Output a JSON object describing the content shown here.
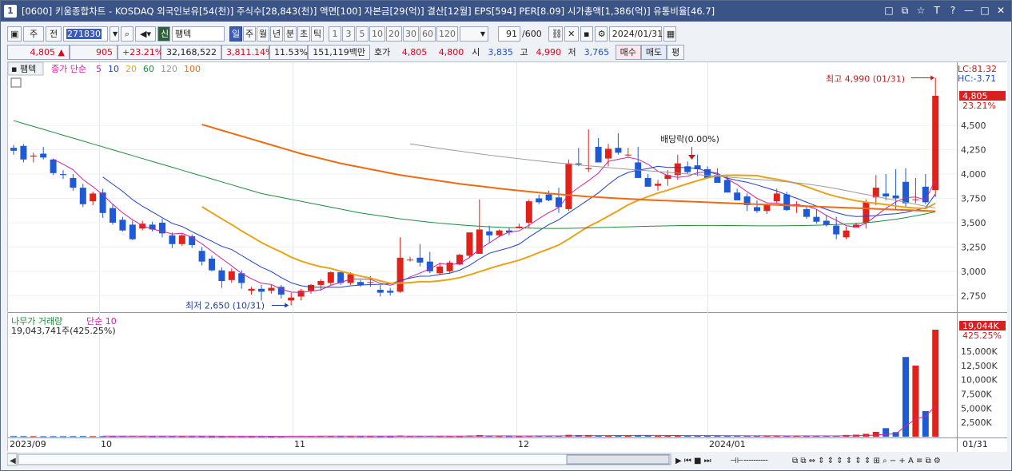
{
  "window": {
    "number": "1",
    "title": "[0600] 키움종합차트 - KOSDAQ 외국인보유[54(천)] 주식수[28,843(천)] 액면[100] 자본금[29(억)] 결산[12월] EPS[594] PER[8.09] 시가총액[1,386(억)] 유통비율[46.7]",
    "controls": [
      "□",
      "⧉",
      "☆",
      "T",
      "?",
      "—",
      "□",
      "✕"
    ]
  },
  "toolbar": {
    "period_label": "주",
    "prev_label": "전",
    "code": "271830",
    "market_badge": "신",
    "stock_name": "팸텍",
    "period_buttons": [
      "일",
      "주",
      "월",
      "년",
      "분",
      "초",
      "틱"
    ],
    "active_period": "일",
    "interval_buttons": [
      "1",
      "3",
      "5",
      "10",
      "20",
      "30",
      "60",
      "120"
    ],
    "count": "91",
    "count_total": "/600",
    "date": "2024/01/31"
  },
  "quote": {
    "price": "4,805",
    "change_arrow": "▲",
    "change": "905",
    "change_pct": "+23.21%",
    "volume": "32,168,522",
    "volume_pct": "3,811.14%",
    "turnover": "11.53%",
    "amount": "151,119백만",
    "hoga_label": "호가",
    "ask": "4,805",
    "bid": "4,800",
    "open_label": "시",
    "open": "3,835",
    "high_label": "고",
    "high": "4,990",
    "low_label": "저",
    "low": "3,765",
    "buy_label": "매수",
    "sell_label": "매도",
    "pyeong_label": "평"
  },
  "chart_legend": {
    "name": "팸텍",
    "ma_label": "종가 단순",
    "ma_periods": [
      "5",
      "10",
      "20",
      "60",
      "120",
      "100"
    ],
    "ma_colors": [
      "#d3209e",
      "#1f3fd0",
      "#e8a317",
      "#1c8c3c",
      "#999999",
      "#ef6a10"
    ],
    "lc": "LC:81.32",
    "hc": "HC:-3.71",
    "price_tag": "4,805",
    "price_tag_pct": "23.21%",
    "high_note": "최고 4,990 (01/31)",
    "low_note": "최저 2,650 (10/31)",
    "dividend_note": "배당락(0.00%)"
  },
  "volume_legend": {
    "name": "나무가 거래량",
    "ma_label": "단순 10",
    "value_text": "19,043,741주(425.25%)",
    "tag": "19,044K",
    "tag_pct": "425.25%"
  },
  "x_labels": [
    "2023/09",
    "10",
    "11",
    "12",
    "2024/01",
    "01/31"
  ],
  "colors": {
    "up": "#e0221b",
    "down": "#1f5ad6",
    "tag": "#d92020"
  },
  "chart_data": {
    "type": "candlestick",
    "title": "",
    "price_axis": {
      "ticks": [
        4500,
        4250,
        4000,
        3750,
        3500,
        3250,
        3000,
        2750
      ],
      "ylim": [
        2580,
        5150
      ]
    },
    "volume_axis": {
      "ticks": [
        "15,000K",
        "12,500K",
        "10,000K",
        "7,500K",
        "5,000K",
        "2,500K"
      ],
      "ylim": [
        0,
        19500
      ]
    },
    "candles": [
      {
        "o": 4270,
        "h": 4300,
        "l": 4200,
        "c": 4240
      },
      {
        "o": 4290,
        "h": 4310,
        "l": 4120,
        "c": 4150
      },
      {
        "o": 4180,
        "h": 4220,
        "l": 4120,
        "c": 4190
      },
      {
        "o": 4210,
        "h": 4280,
        "l": 4150,
        "c": 4170
      },
      {
        "o": 4150,
        "h": 4160,
        "l": 3990,
        "c": 4010
      },
      {
        "o": 4000,
        "h": 4040,
        "l": 3950,
        "c": 3990
      },
      {
        "o": 3960,
        "h": 4000,
        "l": 3830,
        "c": 3860
      },
      {
        "o": 3860,
        "h": 3900,
        "l": 3660,
        "c": 3690
      },
      {
        "o": 3720,
        "h": 3820,
        "l": 3680,
        "c": 3800
      },
      {
        "o": 3810,
        "h": 3850,
        "l": 3550,
        "c": 3600
      },
      {
        "o": 3650,
        "h": 3690,
        "l": 3480,
        "c": 3500
      },
      {
        "o": 3530,
        "h": 3560,
        "l": 3410,
        "c": 3420
      },
      {
        "o": 3480,
        "h": 3520,
        "l": 3320,
        "c": 3330
      },
      {
        "o": 3440,
        "h": 3520,
        "l": 3420,
        "c": 3490
      },
      {
        "o": 3480,
        "h": 3510,
        "l": 3410,
        "c": 3430
      },
      {
        "o": 3500,
        "h": 3540,
        "l": 3350,
        "c": 3390
      },
      {
        "o": 3370,
        "h": 3400,
        "l": 3240,
        "c": 3280
      },
      {
        "o": 3280,
        "h": 3390,
        "l": 3260,
        "c": 3370
      },
      {
        "o": 3360,
        "h": 3380,
        "l": 3240,
        "c": 3270
      },
      {
        "o": 3210,
        "h": 3250,
        "l": 3060,
        "c": 3100
      },
      {
        "o": 3130,
        "h": 3160,
        "l": 3000,
        "c": 3010
      },
      {
        "o": 3010,
        "h": 3040,
        "l": 2830,
        "c": 2900
      },
      {
        "o": 2910,
        "h": 3030,
        "l": 2880,
        "c": 3000
      },
      {
        "o": 2980,
        "h": 3010,
        "l": 2820,
        "c": 2880
      },
      {
        "o": 2800,
        "h": 2840,
        "l": 2760,
        "c": 2820
      },
      {
        "o": 2820,
        "h": 2860,
        "l": 2700,
        "c": 2790
      },
      {
        "o": 2800,
        "h": 2860,
        "l": 2770,
        "c": 2830
      },
      {
        "o": 2840,
        "h": 2860,
        "l": 2720,
        "c": 2760
      },
      {
        "o": 2700,
        "h": 2780,
        "l": 2650,
        "c": 2730
      },
      {
        "o": 2740,
        "h": 2820,
        "l": 2700,
        "c": 2800
      },
      {
        "o": 2800,
        "h": 2870,
        "l": 2770,
        "c": 2860
      },
      {
        "o": 2860,
        "h": 2920,
        "l": 2800,
        "c": 2900
      },
      {
        "o": 2880,
        "h": 3000,
        "l": 2860,
        "c": 2990
      },
      {
        "o": 2990,
        "h": 3010,
        "l": 2860,
        "c": 2880
      },
      {
        "o": 2880,
        "h": 2990,
        "l": 2860,
        "c": 2970
      },
      {
        "o": 2890,
        "h": 2910,
        "l": 2840,
        "c": 2860
      },
      {
        "o": 2890,
        "h": 2950,
        "l": 2840,
        "c": 2890
      },
      {
        "o": 2810,
        "h": 2860,
        "l": 2740,
        "c": 2780
      },
      {
        "o": 2800,
        "h": 2830,
        "l": 2750,
        "c": 2780
      },
      {
        "o": 2790,
        "h": 3350,
        "l": 2780,
        "c": 3140
      },
      {
        "o": 3120,
        "h": 3150,
        "l": 3100,
        "c": 3120
      },
      {
        "o": 3140,
        "h": 3280,
        "l": 3050,
        "c": 3090
      },
      {
        "o": 3100,
        "h": 3200,
        "l": 2980,
        "c": 3000
      },
      {
        "o": 2980,
        "h": 3090,
        "l": 2960,
        "c": 3050
      },
      {
        "o": 3000,
        "h": 3110,
        "l": 2980,
        "c": 3090
      },
      {
        "o": 3070,
        "h": 3180,
        "l": 3060,
        "c": 3170
      },
      {
        "o": 3160,
        "h": 3380,
        "l": 3140,
        "c": 3400
      },
      {
        "o": 3180,
        "h": 3740,
        "l": 3180,
        "c": 3430
      },
      {
        "o": 3410,
        "h": 3470,
        "l": 3290,
        "c": 3370
      },
      {
        "o": 3370,
        "h": 3430,
        "l": 3350,
        "c": 3420
      },
      {
        "o": 3420,
        "h": 3450,
        "l": 3370,
        "c": 3400
      },
      {
        "o": 3450,
        "h": 3490,
        "l": 3440,
        "c": 3460
      },
      {
        "o": 3500,
        "h": 3740,
        "l": 3450,
        "c": 3720
      },
      {
        "o": 3750,
        "h": 3790,
        "l": 3690,
        "c": 3710
      },
      {
        "o": 3790,
        "h": 3830,
        "l": 3720,
        "c": 3730
      },
      {
        "o": 3760,
        "h": 3860,
        "l": 3600,
        "c": 3660
      },
      {
        "o": 3640,
        "h": 4150,
        "l": 3620,
        "c": 4110
      },
      {
        "o": 4110,
        "h": 4270,
        "l": 4080,
        "c": 4100
      },
      {
        "o": 4050,
        "h": 4460,
        "l": 4020,
        "c": 4060
      },
      {
        "o": 4280,
        "h": 4370,
        "l": 4130,
        "c": 4120
      },
      {
        "o": 4160,
        "h": 4310,
        "l": 4080,
        "c": 4260
      },
      {
        "o": 4270,
        "h": 4420,
        "l": 4200,
        "c": 4220
      },
      {
        "o": 4200,
        "h": 4270,
        "l": 4180,
        "c": 4200
      },
      {
        "o": 4120,
        "h": 4280,
        "l": 4000,
        "c": 3960
      },
      {
        "o": 3960,
        "h": 4000,
        "l": 3920,
        "c": 3870
      },
      {
        "o": 3880,
        "h": 3940,
        "l": 3830,
        "c": 3900
      },
      {
        "o": 3950,
        "h": 4040,
        "l": 3880,
        "c": 3990
      },
      {
        "o": 3990,
        "h": 4200,
        "l": 3940,
        "c": 4110
      },
      {
        "o": 4080,
        "h": 4130,
        "l": 4000,
        "c": 4020
      },
      {
        "o": 4090,
        "h": 4200,
        "l": 3980,
        "c": 4050
      },
      {
        "o": 4050,
        "h": 4080,
        "l": 3970,
        "c": 3960
      },
      {
        "o": 3990,
        "h": 4060,
        "l": 3910,
        "c": 3910
      },
      {
        "o": 3940,
        "h": 3990,
        "l": 3830,
        "c": 3810
      },
      {
        "o": 3810,
        "h": 3850,
        "l": 3760,
        "c": 3730
      },
      {
        "o": 3770,
        "h": 3800,
        "l": 3620,
        "c": 3680
      },
      {
        "o": 3660,
        "h": 3730,
        "l": 3600,
        "c": 3620
      },
      {
        "o": 3620,
        "h": 3690,
        "l": 3590,
        "c": 3680
      },
      {
        "o": 3720,
        "h": 3850,
        "l": 3700,
        "c": 3800
      },
      {
        "o": 3790,
        "h": 3820,
        "l": 3620,
        "c": 3630
      },
      {
        "o": 3680,
        "h": 3720,
        "l": 3600,
        "c": 3690
      },
      {
        "o": 3640,
        "h": 3670,
        "l": 3540,
        "c": 3560
      },
      {
        "o": 3560,
        "h": 3640,
        "l": 3490,
        "c": 3510
      },
      {
        "o": 3520,
        "h": 3580,
        "l": 3460,
        "c": 3480
      },
      {
        "o": 3470,
        "h": 3560,
        "l": 3330,
        "c": 3380
      },
      {
        "o": 3350,
        "h": 3460,
        "l": 3330,
        "c": 3420
      },
      {
        "o": 3450,
        "h": 3500,
        "l": 3450,
        "c": 3480
      },
      {
        "o": 3500,
        "h": 3740,
        "l": 3440,
        "c": 3710
      },
      {
        "o": 3760,
        "h": 3990,
        "l": 3680,
        "c": 3860
      },
      {
        "o": 3800,
        "h": 4000,
        "l": 3730,
        "c": 3770
      },
      {
        "o": 3780,
        "h": 4050,
        "l": 3640,
        "c": 3750
      },
      {
        "o": 3920,
        "h": 4060,
        "l": 3650,
        "c": 3700
      },
      {
        "o": 3740,
        "h": 3960,
        "l": 3700,
        "c": 3740
      },
      {
        "o": 3870,
        "h": 4000,
        "l": 3690,
        "c": 3710
      },
      {
        "o": 3835,
        "h": 4990,
        "l": 3765,
        "c": 4805
      }
    ],
    "volumes_k": [
      120,
      110,
      100,
      90,
      95,
      100,
      110,
      120,
      105,
      100,
      95,
      115,
      140,
      120,
      90,
      100,
      95,
      90,
      80,
      75,
      60,
      70,
      90,
      85,
      70,
      80,
      60,
      80,
      140,
      150,
      120,
      110,
      100,
      90,
      95,
      85,
      90,
      80,
      70,
      200,
      110,
      120,
      130,
      100,
      95,
      90,
      180,
      280,
      120,
      110,
      100,
      90,
      150,
      140,
      160,
      130,
      330,
      280,
      300,
      200,
      180,
      220,
      210,
      260,
      200,
      150,
      170,
      180,
      200,
      190,
      150,
      140,
      160,
      140,
      150,
      130,
      170,
      130,
      120,
      140,
      110,
      120,
      130,
      170,
      300,
      350,
      500,
      850,
      1500,
      800,
      14000,
      12500,
      4500,
      18800
    ]
  }
}
